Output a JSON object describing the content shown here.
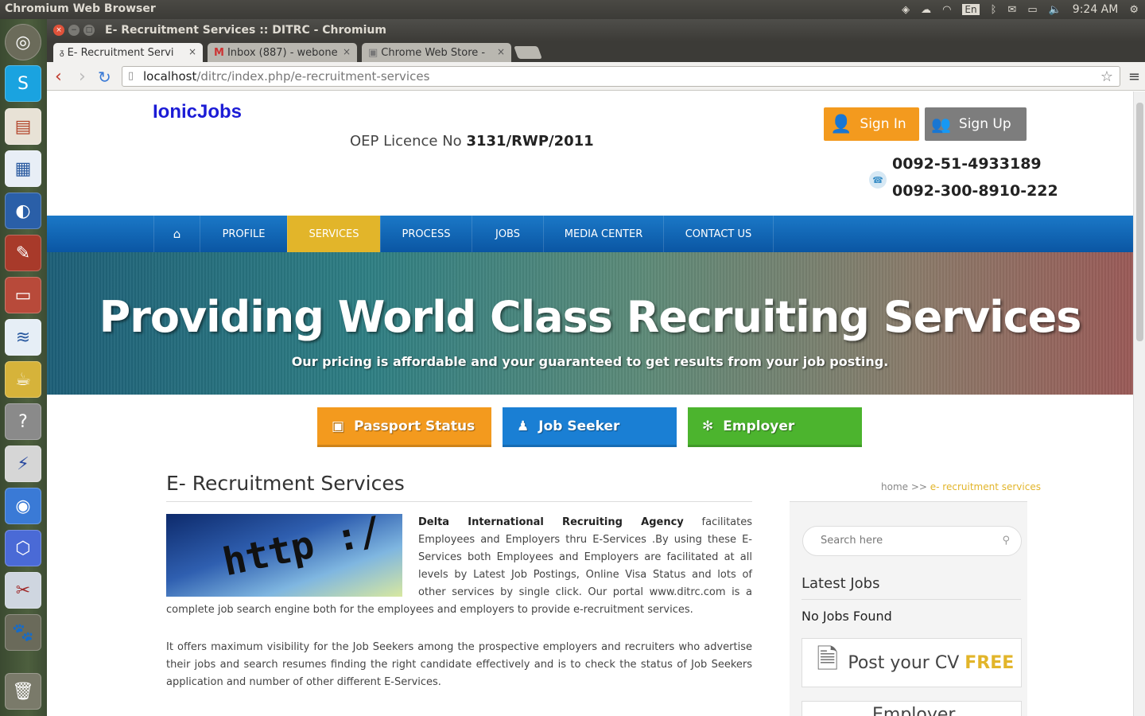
{
  "os": {
    "title": "Chromium Web Browser",
    "keyboard": "En",
    "clock": "9:24 AM"
  },
  "window": {
    "title": "E- Recruitment Services :: DITRC - Chromium"
  },
  "tabs": [
    {
      "label": "E- Recruitment Servi",
      "close": "×"
    },
    {
      "label": "Inbox (887) - webone",
      "close": "×"
    },
    {
      "label": "Chrome Web Store -",
      "close": "×"
    }
  ],
  "address": {
    "host": "localhost",
    "path": "/ditrc/index.php/e-recruitment-services"
  },
  "header": {
    "logo": "IonicJobs",
    "licence_label": "OEP Licence No",
    "licence_no": "3131/RWP/2011",
    "signin": "Sign In",
    "signup": "Sign Up",
    "phone1": "0092-51-4933189",
    "phone2": "0092-300-8910-222"
  },
  "nav": [
    "PROFILE",
    "SERVICES",
    "PROCESS",
    "JOBS",
    "MEDIA CENTER",
    "CONTACT US"
  ],
  "hero": {
    "title": "Providing World Class Recruiting Services",
    "subtitle": "Our pricing is affordable and your guaranteed to get results from your job posting."
  },
  "cta": [
    "Passport Status",
    "Job Seeker",
    "Employer"
  ],
  "page": {
    "title": "E- Recruitment Services",
    "crumb_home": "home >>",
    "crumb_current": "e- recruitment services",
    "image_text": "http :/",
    "para1_bold": "Delta International Recruiting Agency",
    "para1": " facilitates Employees and Employers thru E-Services .By using these E-Services both Employees and Employers are facilitated at all levels by Latest Job Postings, Online Visa Status and lots of other services by single click. Our portal www.ditrc.com is a complete job search engine both for the employees and employers to provide e-recruitment services.",
    "para2": "It offers maximum visibility for the Job Seekers among the prospective employers and recruiters who advertise their jobs and search resumes finding the right candidate effectively and is to check the status of Job Seekers application and number of other different E-Services."
  },
  "sidebar": {
    "search_placeholder": "Search here",
    "latest_title": "Latest Jobs",
    "no_jobs": "No Jobs Found",
    "cv_text": "Post your CV",
    "cv_free": "FREE",
    "employer_text": "Employer"
  },
  "colors": {
    "orange": "#f39a1e",
    "blue": "#1a7fd4",
    "green": "#4cb42e",
    "gold": "#e2b52a",
    "logo": "#1c1cd6"
  }
}
